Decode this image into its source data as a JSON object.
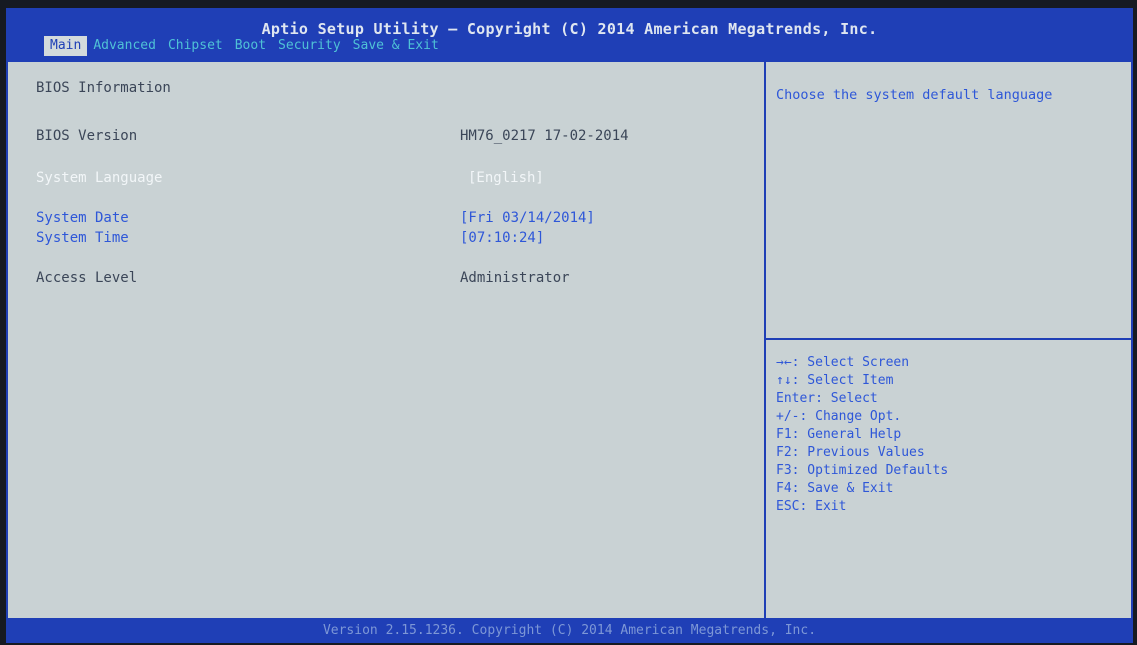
{
  "header": {
    "title": "Aptio Setup Utility – Copyright (C) 2014 American Megatrends, Inc.",
    "tabs": [
      "Main",
      "Advanced",
      "Chipset",
      "Boot",
      "Security",
      "Save & Exit"
    ],
    "active_tab": "Main"
  },
  "main": {
    "section_title": "BIOS Information",
    "bios_version_label": "BIOS Version",
    "bios_version_value": "HM76_0217 17-02-2014",
    "system_language_label": "System Language",
    "system_language_value": "[English]",
    "system_date_label": "System Date",
    "system_date_value": "[Fri 03/14/2014]",
    "system_time_label": "System Time",
    "system_time_value": "[07:10:24]",
    "access_level_label": "Access Level",
    "access_level_value": "Administrator"
  },
  "help": {
    "description": "Choose the system default language",
    "keys": [
      "→←: Select Screen",
      "↑↓: Select Item",
      "Enter: Select",
      "+/-: Change Opt.",
      "F1: General Help",
      "F2: Previous Values",
      "F3: Optimized Defaults",
      "F4: Save & Exit",
      "ESC: Exit"
    ]
  },
  "footer": {
    "text": "Version 2.15.1236. Copyright (C) 2014 American Megatrends, Inc."
  },
  "colors": {
    "frame_blue": "#1f3fb6",
    "background": "#c9d2d4",
    "link_blue": "#2e57d8",
    "tab_cyan": "#4fc2d6",
    "text_gray": "#3b4658"
  }
}
